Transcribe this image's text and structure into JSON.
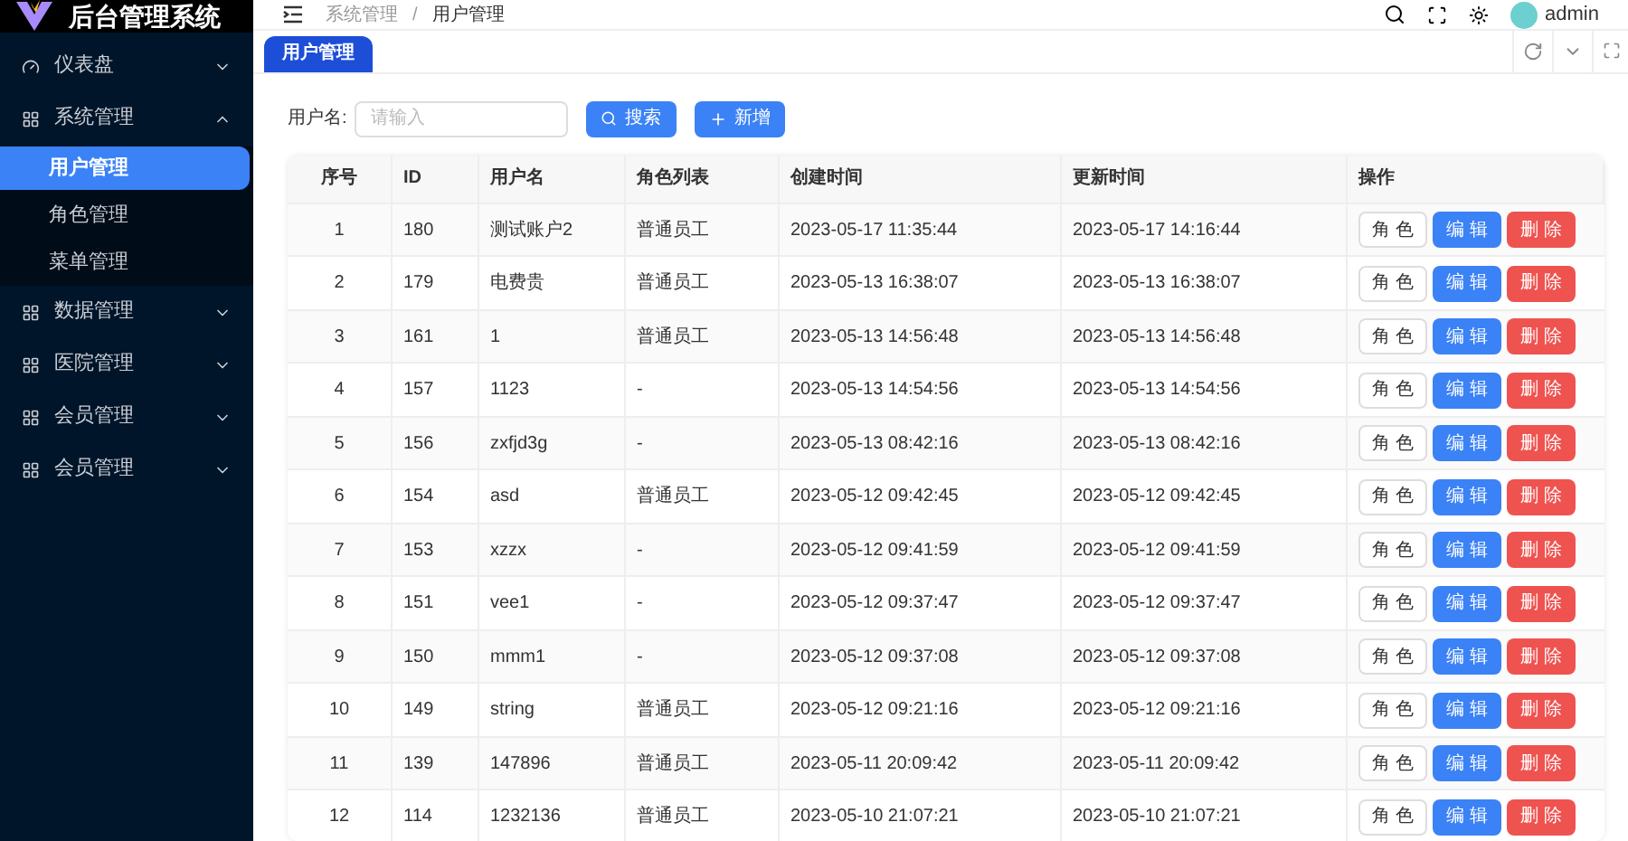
{
  "app": {
    "title": "后台管理系统"
  },
  "sidebar": {
    "items": [
      {
        "label": "仪表盘",
        "kind": "dashboard",
        "expanded": false
      },
      {
        "label": "系统管理",
        "kind": "group",
        "expanded": true,
        "children": [
          {
            "label": "用户管理",
            "selected": true
          },
          {
            "label": "角色管理",
            "selected": false
          },
          {
            "label": "菜单管理",
            "selected": false
          }
        ]
      },
      {
        "label": "数据管理",
        "kind": "group",
        "expanded": false
      },
      {
        "label": "医院管理",
        "kind": "group",
        "expanded": false
      },
      {
        "label": "会员管理",
        "kind": "group",
        "expanded": false
      },
      {
        "label": "会员管理",
        "kind": "group",
        "expanded": false
      }
    ]
  },
  "breadcrumb": [
    "系统管理",
    "用户管理"
  ],
  "breadcrumb_separator": "/",
  "user": {
    "name": "admin"
  },
  "tabs": [
    {
      "label": "用户管理",
      "selected": true
    }
  ],
  "search": {
    "label": "用户名:",
    "placeholder": "请输入",
    "search_button": "搜索",
    "add_button": "新增"
  },
  "table": {
    "columns": [
      "序号",
      "ID",
      "用户名",
      "角色列表",
      "创建时间",
      "更新时间",
      "操作"
    ],
    "rows": [
      {
        "cells": [
          "1",
          "180",
          "测试账户2",
          "普通员工",
          "2023-05-17 11:35:44",
          "2023-05-17 14:16:44"
        ],
        "actions": [
          "角 色",
          "编 辑",
          "删 除"
        ]
      },
      {
        "cells": [
          "2",
          "179",
          "电费贵",
          "普通员工",
          "2023-05-13 16:38:07",
          "2023-05-13 16:38:07"
        ],
        "actions": [
          "角 色",
          "编 辑",
          "删 除"
        ]
      },
      {
        "cells": [
          "3",
          "161",
          "1",
          "普通员工",
          "2023-05-13 14:56:48",
          "2023-05-13 14:56:48"
        ],
        "actions": [
          "角 色",
          "编 辑",
          "删 除"
        ]
      },
      {
        "cells": [
          "4",
          "157",
          "1123",
          "-",
          "2023-05-13 14:54:56",
          "2023-05-13 14:54:56"
        ],
        "actions": [
          "角 色",
          "编 辑",
          "删 除"
        ]
      },
      {
        "cells": [
          "5",
          "156",
          "zxfjd3g",
          "-",
          "2023-05-13 08:42:16",
          "2023-05-13 08:42:16"
        ],
        "actions": [
          "角 色",
          "编 辑",
          "删 除"
        ]
      },
      {
        "cells": [
          "6",
          "154",
          "asd",
          "普通员工",
          "2023-05-12 09:42:45",
          "2023-05-12 09:42:45"
        ],
        "actions": [
          "角 色",
          "编 辑",
          "删 除"
        ]
      },
      {
        "cells": [
          "7",
          "153",
          "xzzx",
          "-",
          "2023-05-12 09:41:59",
          "2023-05-12 09:41:59"
        ],
        "actions": [
          "角 色",
          "编 辑",
          "删 除"
        ]
      },
      {
        "cells": [
          "8",
          "151",
          "vee1",
          "-",
          "2023-05-12 09:37:47",
          "2023-05-12 09:37:47"
        ],
        "actions": [
          "角 色",
          "编 辑",
          "删 除"
        ]
      },
      {
        "cells": [
          "9",
          "150",
          "mmm1",
          "-",
          "2023-05-12 09:37:08",
          "2023-05-12 09:37:08"
        ],
        "actions": [
          "角 色",
          "编 辑",
          "删 除"
        ]
      },
      {
        "cells": [
          "10",
          "149",
          "string",
          "普通员工",
          "2023-05-12 09:21:16",
          "2023-05-12 09:21:16"
        ],
        "actions": [
          "角 色",
          "编 辑",
          "删 除"
        ]
      },
      {
        "cells": [
          "11",
          "139",
          "147896",
          "普通员工",
          "2023-05-11 20:09:42",
          "2023-05-11 20:09:42"
        ],
        "actions": [
          "角 色",
          "编 辑",
          "删 除"
        ]
      },
      {
        "cells": [
          "12",
          "114",
          "1232136",
          "普通员工",
          "2023-05-10 21:07:21",
          "2023-05-10 21:07:21"
        ],
        "actions": [
          "角 色",
          "编 辑",
          "删 除"
        ]
      }
    ]
  }
}
